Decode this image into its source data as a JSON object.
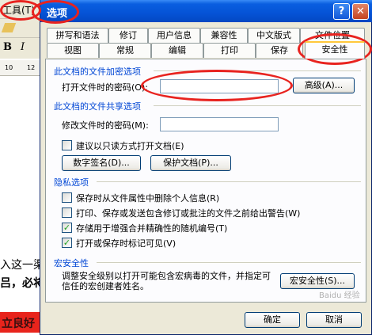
{
  "background": {
    "menu_tools": "工具(T)",
    "format_bold": "B",
    "format_italic": "I",
    "ruler_marks": [
      "10",
      "12"
    ],
    "doc_line1": "入这一渠",
    "doc_line2": "吕，必将",
    "doc_line3": "立良好"
  },
  "dialog": {
    "title": "选项",
    "help_button": "?",
    "close_button": "✕",
    "tabs_row1": [
      "拼写和语法",
      "修订",
      "用户信息",
      "兼容性",
      "中文版式",
      "文件位置"
    ],
    "tabs_row2": [
      "视图",
      "常规",
      "编辑",
      "打印",
      "保存",
      "安全性"
    ],
    "active_tab": "安全性",
    "encryption": {
      "section": "此文档的文件加密选项",
      "open_password_label": "打开文件时的密码(O):",
      "open_password_value": "",
      "advanced_button": "高级(A)..."
    },
    "sharing": {
      "section": "此文档的文件共享选项",
      "modify_password_label": "修改文件时的密码(M):",
      "modify_password_value": "",
      "readonly_label": "建议以只读方式打开文档(E)",
      "digital_signature_button": "数字签名(D)...",
      "protect_document_button": "保护文档(P)..."
    },
    "privacy": {
      "section": "隐私选项",
      "options": [
        {
          "label": "保存时从文件属性中删除个人信息(R)",
          "checked": false
        },
        {
          "label": "打印、保存或发送包含修订或批注的文件之前给出警告(W)",
          "checked": false
        },
        {
          "label": "存储用于增强合并精确性的随机编号(T)",
          "checked": true
        },
        {
          "label": "打开或保存时标记可见(V)",
          "checked": true
        }
      ]
    },
    "macro": {
      "section": "宏安全性",
      "description": "调整安全级别以打开可能包含宏病毒的文件，并指定可信任的宏创建者姓名。",
      "macro_security_button": "宏安全性(S)..."
    },
    "ok_button": "确定",
    "cancel_button": "取消"
  },
  "watermark": "Baidu 经验"
}
